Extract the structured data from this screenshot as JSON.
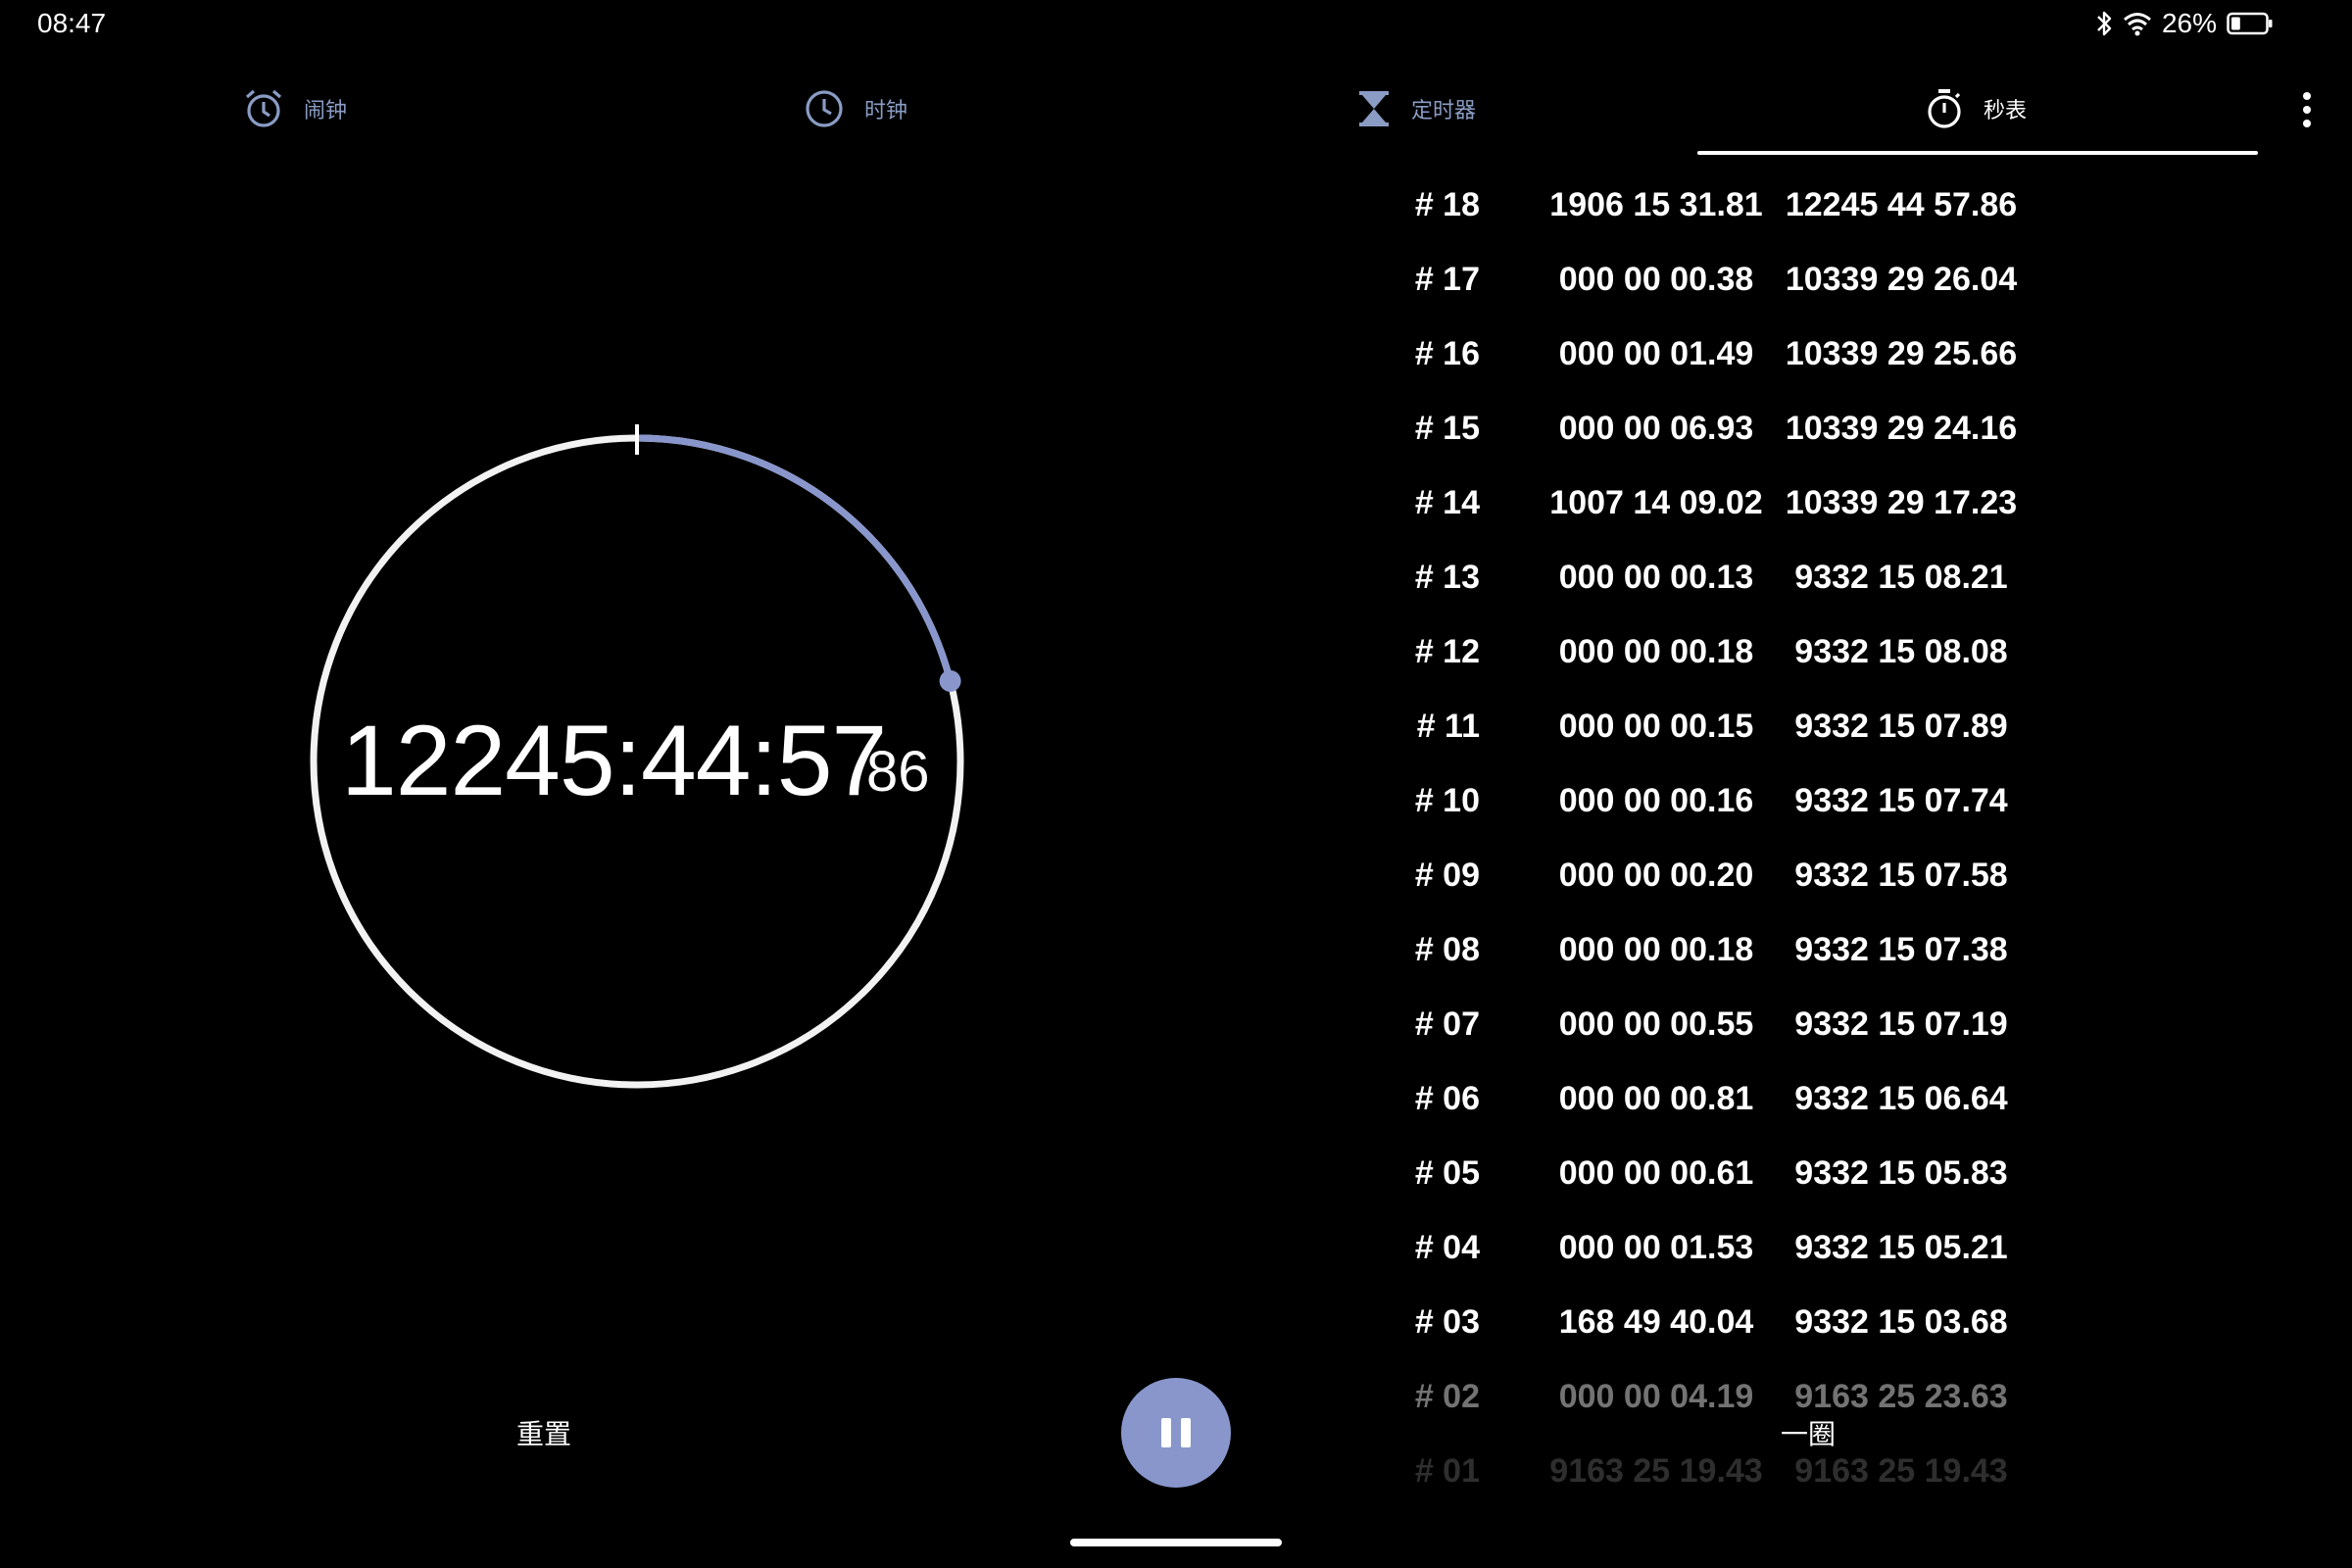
{
  "status_bar": {
    "time": "08:47",
    "battery_percent": "26%",
    "battery_level": 0.26,
    "icons": [
      "bluetooth-icon",
      "wifi-icon",
      "battery-icon"
    ]
  },
  "tabs": [
    {
      "label": "闹钟",
      "icon": "alarm-icon",
      "active": false
    },
    {
      "label": "时钟",
      "icon": "clock-icon",
      "active": false
    },
    {
      "label": "定时器",
      "icon": "hourglass-icon",
      "active": false
    },
    {
      "label": "秒表",
      "icon": "stopwatch-icon",
      "active": true
    }
  ],
  "stopwatch": {
    "main_time": "12245:44:57",
    "hundredths": "86",
    "dial_progress": 0.21,
    "accent_color": "#8896cc"
  },
  "laps": [
    {
      "num": "# 18",
      "split": "1906 15 31.81",
      "total": "12245 44 57.86"
    },
    {
      "num": "# 17",
      "split": "000 00 00.38",
      "total": "10339 29 26.04"
    },
    {
      "num": "# 16",
      "split": "000 00 01.49",
      "total": "10339 29 25.66"
    },
    {
      "num": "# 15",
      "split": "000 00 06.93",
      "total": "10339 29 24.16"
    },
    {
      "num": "# 14",
      "split": "1007 14 09.02",
      "total": "10339 29 17.23"
    },
    {
      "num": "# 13",
      "split": "000 00 00.13",
      "total": "9332 15 08.21"
    },
    {
      "num": "# 12",
      "split": "000 00 00.18",
      "total": "9332 15 08.08"
    },
    {
      "num": "# 11",
      "split": "000 00 00.15",
      "total": "9332 15 07.89"
    },
    {
      "num": "# 10",
      "split": "000 00 00.16",
      "total": "9332 15 07.74"
    },
    {
      "num": "# 09",
      "split": "000 00 00.20",
      "total": "9332 15 07.58"
    },
    {
      "num": "# 08",
      "split": "000 00 00.18",
      "total": "9332 15 07.38"
    },
    {
      "num": "# 07",
      "split": "000 00 00.55",
      "total": "9332 15 07.19"
    },
    {
      "num": "# 06",
      "split": "000 00 00.81",
      "total": "9332 15 06.64"
    },
    {
      "num": "# 05",
      "split": "000 00 00.61",
      "total": "9332 15 05.83"
    },
    {
      "num": "# 04",
      "split": "000 00 01.53",
      "total": "9332 15 05.21"
    },
    {
      "num": "# 03",
      "split": "168 49 40.04",
      "total": "9332 15 03.68"
    },
    {
      "num": "# 02",
      "split": "000 00 04.19",
      "total": "9163 25 23.63"
    },
    {
      "num": "# 01",
      "split": "9163 25 19.43",
      "total": "9163 25 19.43"
    }
  ],
  "controls": {
    "reset_label": "重置",
    "lap_label": "一圈",
    "pause_icon": "pause-icon"
  }
}
